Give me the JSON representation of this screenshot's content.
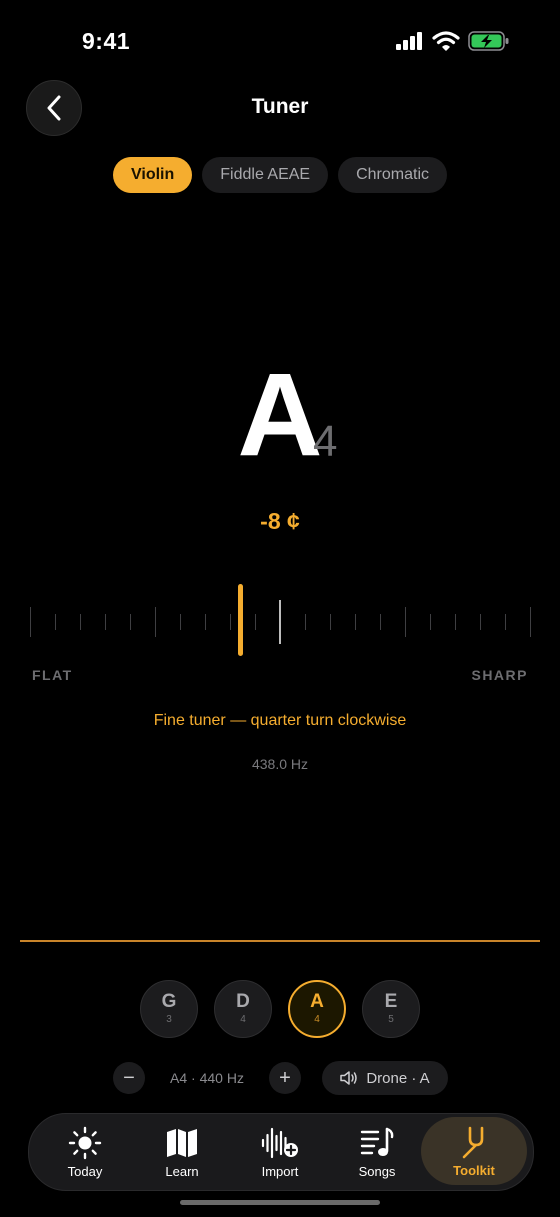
{
  "status": {
    "time": "9:41"
  },
  "header": {
    "title": "Tuner"
  },
  "modes": [
    {
      "label": "Violin",
      "active": true
    },
    {
      "label": "Fiddle AEAE",
      "active": false
    },
    {
      "label": "Chromatic",
      "active": false
    }
  ],
  "reading": {
    "note": "A",
    "octave": "4",
    "cents_label": "-8 ¢",
    "cents_value": -8,
    "flat_label": "FLAT",
    "sharp_label": "SHARP",
    "hint": "Fine tuner — quarter turn clockwise",
    "frequency": "438.0 Hz"
  },
  "strings": [
    {
      "note": "G",
      "octave": "3",
      "active": false
    },
    {
      "note": "D",
      "octave": "4",
      "active": false
    },
    {
      "note": "A",
      "octave": "4",
      "active": true
    },
    {
      "note": "E",
      "octave": "5",
      "active": false
    }
  ],
  "reference": {
    "minus": "−",
    "label": "A4 · 440 Hz",
    "plus": "+",
    "drone_label": "Drone · A"
  },
  "tabbar": {
    "items": [
      {
        "label": "Today",
        "icon": "sun-icon",
        "active": false
      },
      {
        "label": "Learn",
        "icon": "map-icon",
        "active": false
      },
      {
        "label": "Import",
        "icon": "waveform-plus-icon",
        "active": false
      },
      {
        "label": "Songs",
        "icon": "music-list-icon",
        "active": false
      },
      {
        "label": "Toolkit",
        "icon": "tuning-fork-icon",
        "active": true
      }
    ]
  },
  "colors": {
    "accent": "#f5ad2f",
    "background": "#000000"
  }
}
